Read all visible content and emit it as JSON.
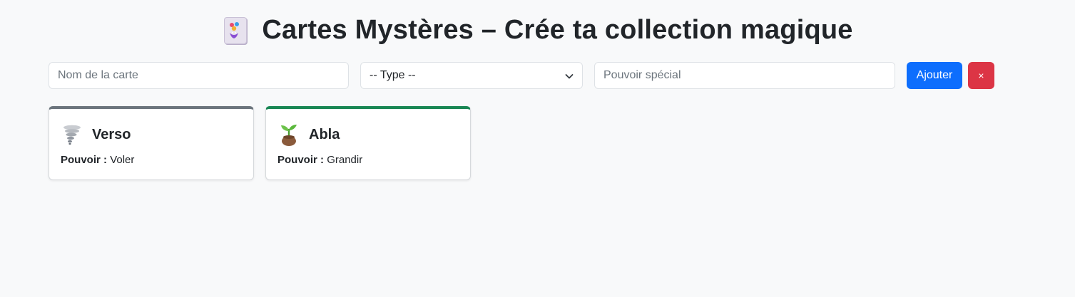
{
  "header": {
    "title": "Cartes Mystères – Crée ta collection magique",
    "icon": "joker-card-icon"
  },
  "form": {
    "name_placeholder": "Nom de la carte",
    "type_selected": "-- Type --",
    "power_placeholder": "Pouvoir spécial",
    "add_label": "Ajouter",
    "clear_label": "×"
  },
  "cards": [
    {
      "name": "Verso",
      "power_label": "Pouvoir :",
      "power": "Voler",
      "icon": "tornado-icon",
      "accent": "#6c757d"
    },
    {
      "name": "Abla",
      "power_label": "Pouvoir :",
      "power": "Grandir",
      "icon": "seedling-icon",
      "accent": "#198754"
    }
  ],
  "colors": {
    "background": "#f8f9fa",
    "primary": "#0d6efd",
    "danger": "#dc3545"
  }
}
